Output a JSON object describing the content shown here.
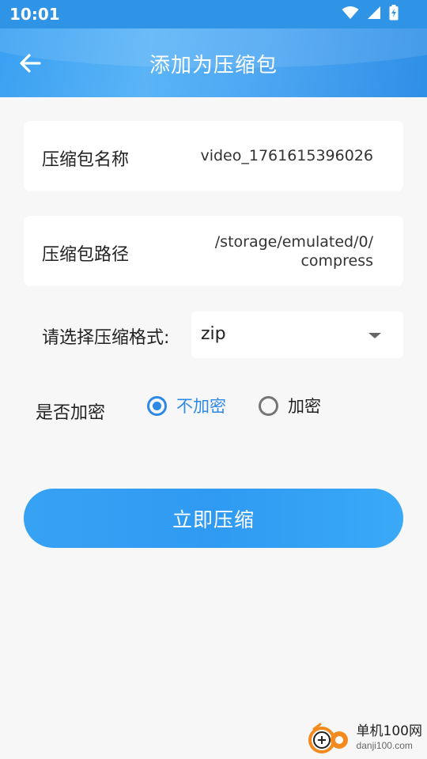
{
  "status_bar": {
    "time": "10:01",
    "icons": [
      "wifi-icon",
      "signal-icon",
      "battery-charging-icon"
    ]
  },
  "header": {
    "title": "添加为压缩包",
    "back_icon": "arrow-left-icon"
  },
  "archive_name": {
    "label": "压缩包名称",
    "value": "video_1761615396026"
  },
  "archive_path": {
    "label": "压缩包路径",
    "value_line1": "/storage/emulated/0/",
    "value_line2": "compress"
  },
  "format": {
    "label": "请选择压缩格式:",
    "selected": "zip"
  },
  "encryption": {
    "label": "是否加密",
    "options": [
      {
        "label": "不加密",
        "checked": true
      },
      {
        "label": "加密",
        "checked": false
      }
    ]
  },
  "action": {
    "compress_label": "立即压缩"
  },
  "watermark": {
    "name": "单机100网",
    "domain": "danji100.com"
  },
  "colors": {
    "accent": "#2e89e6",
    "header": "#3aa0f2",
    "background": "#f7f7f8"
  }
}
